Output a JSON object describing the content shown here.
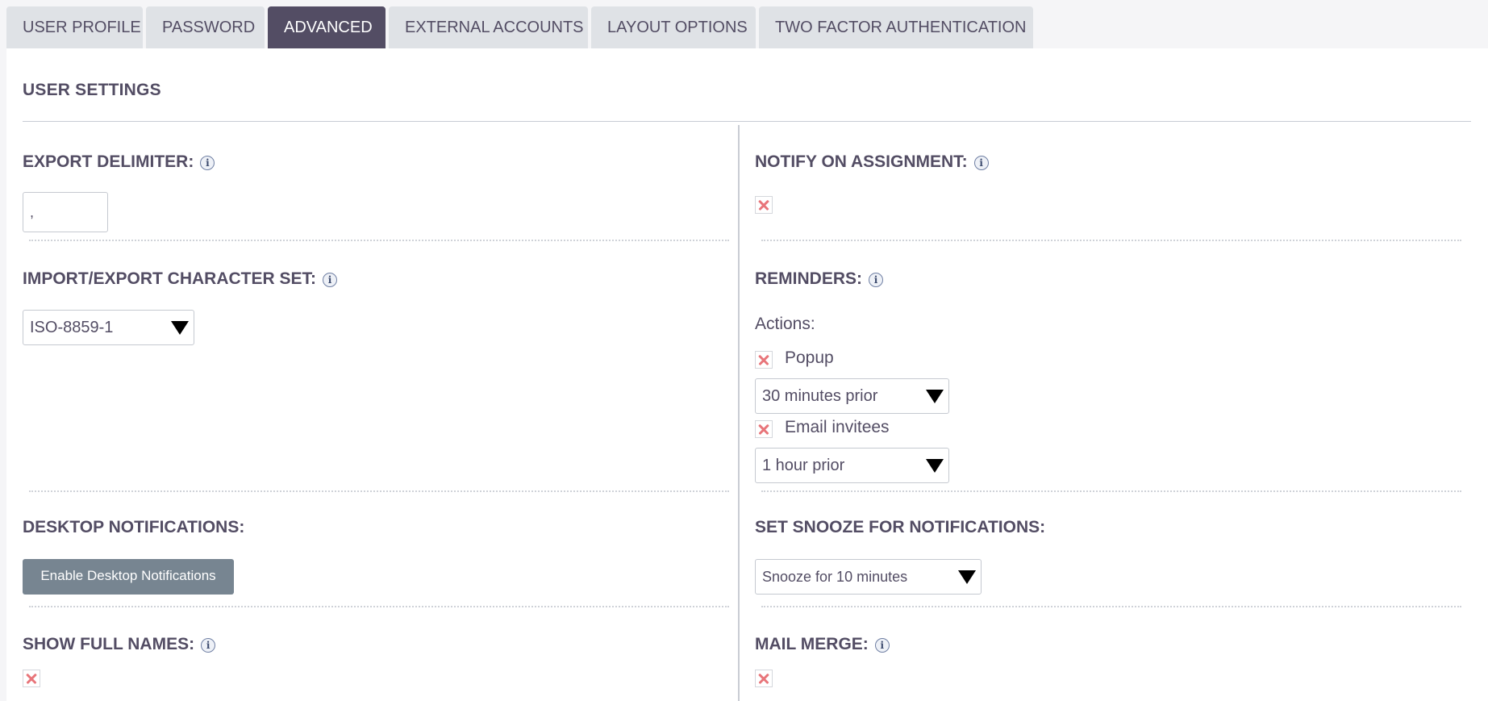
{
  "tabs": [
    {
      "label": "USER PROFILE"
    },
    {
      "label": "PASSWORD"
    },
    {
      "label": "ADVANCED",
      "active": true
    },
    {
      "label": "EXTERNAL ACCOUNTS"
    },
    {
      "label": "LAYOUT OPTIONS"
    },
    {
      "label": "TWO FACTOR AUTHENTICATION"
    }
  ],
  "section": {
    "title": "USER SETTINGS"
  },
  "export_delimiter": {
    "label": "EXPORT DELIMITER:",
    "value": ","
  },
  "charset": {
    "label": "IMPORT/EXPORT CHARACTER SET:",
    "value": "ISO-8859-1"
  },
  "desktop_notifications": {
    "label": "DESKTOP NOTIFICATIONS:",
    "button": "Enable Desktop Notifications"
  },
  "show_full_names": {
    "label": "SHOW FULL NAMES:",
    "checked": false
  },
  "notify_on_assignment": {
    "label": "NOTIFY ON ASSIGNMENT:",
    "checked": false
  },
  "reminders": {
    "label": "REMINDERS:",
    "actions_label": "Actions:",
    "popup": {
      "label": "Popup",
      "checked": false,
      "time": "30 minutes prior"
    },
    "email": {
      "label": "Email invitees",
      "checked": false,
      "time": "1 hour prior"
    }
  },
  "snooze": {
    "label": "SET SNOOZE FOR NOTIFICATIONS:",
    "value": "Snooze for 10 minutes"
  },
  "mail_merge": {
    "label": "MAIL MERGE:",
    "checked": false
  },
  "colors": {
    "accent": "#534d64",
    "tab_bg": "#dfe2e6",
    "button_bg": "#778591",
    "checkbox_x": "#e8757a"
  }
}
